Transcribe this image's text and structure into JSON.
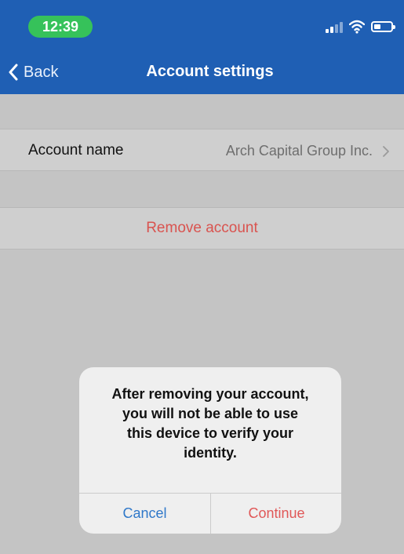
{
  "status_bar": {
    "time": "12:39",
    "icons": [
      "cellular-signal-icon",
      "wifi-icon",
      "battery-icon"
    ]
  },
  "nav_bar": {
    "back_label": "Back",
    "title": "Account settings"
  },
  "settings": {
    "account_row": {
      "label": "Account name",
      "value": "Arch Capital Group Inc."
    },
    "remove_row": {
      "label": "Remove account"
    }
  },
  "dialog": {
    "message": "After removing your account,\nyou will not be able to use\nthis device to verify your\nidentity.",
    "cancel_label": "Cancel",
    "continue_label": "Continue"
  },
  "colors": {
    "nav_bar": "#1f5fb4",
    "status_pill": "#36c25a",
    "destructive": "#d9534f",
    "link_blue": "#2f78c9",
    "background": "#c4c4c4"
  }
}
